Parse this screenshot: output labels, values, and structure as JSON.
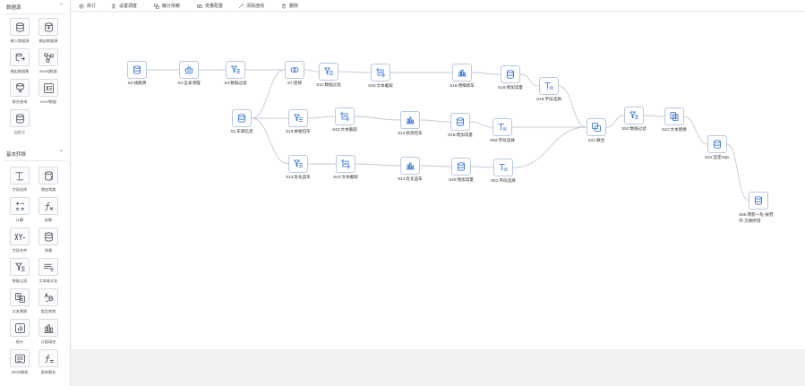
{
  "sidebar": {
    "sections": [
      {
        "title": "数据源",
        "items": [
          {
            "label": "输入数据源",
            "icon": "database-input-icon"
          },
          {
            "label": "输出数据源",
            "icon": "database-output-icon"
          },
          {
            "label": "输出数据集",
            "icon": "dataset-output-icon"
          },
          {
            "label": "Neo4j数据",
            "icon": "graph-nodes-icon"
          },
          {
            "label": "联合查询",
            "icon": "union-query-icon"
          },
          {
            "label": "excel数据",
            "icon": "excel-icon"
          },
          {
            "label": "自定义",
            "icon": "custom-database-icon"
          }
        ]
      },
      {
        "title": "基本转换",
        "items": [
          {
            "label": "字段选择",
            "icon": "field-select-icon"
          },
          {
            "label": "增加常量",
            "icon": "add-constant-icon"
          },
          {
            "label": "计算",
            "icon": "calculator-icon"
          },
          {
            "label": "函数",
            "icon": "function-icon"
          },
          {
            "label": "字段合并",
            "icon": "xy-merge-icon"
          },
          {
            "label": "排重",
            "icon": "dedupe-icon"
          },
          {
            "label": "数据过滤",
            "icon": "filter-icon"
          },
          {
            "label": "文本格式化",
            "icon": "text-format-icon"
          },
          {
            "label": "文本替换",
            "icon": "text-replace-icon"
          },
          {
            "label": "类型转换",
            "icon": "type-convert-icon"
          },
          {
            "label": "统计",
            "icon": "stats-icon"
          },
          {
            "label": "分值填充",
            "icon": "value-fill-icon"
          },
          {
            "label": "JSON解析",
            "icon": "json-parse-icon"
          },
          {
            "label": "表单解析",
            "icon": "form-parse-icon"
          }
        ]
      }
    ]
  },
  "toolbar": {
    "items": [
      {
        "label": "执行",
        "icon": "play-icon"
      },
      {
        "label": "设置调度",
        "icon": "schedule-icon"
      },
      {
        "label": "触分依赖",
        "icon": "dependency-icon"
      },
      {
        "label": "变量配置",
        "icon": "variable-icon"
      },
      {
        "label": "清除连线",
        "icon": "clear-lines-icon"
      },
      {
        "label": "删除",
        "icon": "delete-icon"
      }
    ]
  },
  "flow": {
    "nodes": [
      {
        "id": "n1",
        "label": "S2:线路牌",
        "icon": "database"
      },
      {
        "id": "n2",
        "label": "S4:全表清理",
        "icon": "basket"
      },
      {
        "id": "n3",
        "label": "S3:数据过滤",
        "icon": "filter"
      },
      {
        "id": "n4",
        "label": "S7:连接",
        "icon": "join"
      },
      {
        "id": "n5",
        "label": "S11:数据过滤",
        "icon": "filter"
      },
      {
        "id": "n6",
        "label": "S40:文本截取",
        "icon": "crop"
      },
      {
        "id": "n7",
        "label": "S15:明细寄车",
        "icon": "bars"
      },
      {
        "id": "n8",
        "label": "S18:增加常量",
        "icon": "database"
      },
      {
        "id": "n9",
        "label": "S49:字段选择",
        "icon": "field"
      },
      {
        "id": "n10",
        "label": "S1:车辆信息",
        "icon": "database"
      },
      {
        "id": "n11",
        "label": "S10:依据包车",
        "icon": "filter"
      },
      {
        "id": "n12",
        "label": "S43:文本截取",
        "icon": "crop"
      },
      {
        "id": "n13",
        "label": "S12:统源包车",
        "icon": "bars"
      },
      {
        "id": "n14",
        "label": "S19:增加常量",
        "icon": "database"
      },
      {
        "id": "n15",
        "label": "S50:字段选择",
        "icon": "field"
      },
      {
        "id": "n16",
        "label": "S21:联合",
        "icon": "merge"
      },
      {
        "id": "n17",
        "label": "S52:数据过滤",
        "icon": "filter"
      },
      {
        "id": "n18",
        "label": "S41:文本替换",
        "icon": "copy"
      },
      {
        "id": "n19",
        "label": "S31:自定SQL",
        "icon": "database"
      },
      {
        "id": "n20",
        "label": "S13:危化品车",
        "icon": "filter"
      },
      {
        "id": "n21",
        "label": "S44:文本截取",
        "icon": "crop"
      },
      {
        "id": "n22",
        "label": "S14:危化品车",
        "icon": "bars"
      },
      {
        "id": "n23",
        "label": "S20:增加常量",
        "icon": "database"
      },
      {
        "id": "n24",
        "label": "S51:字段选择",
        "icon": "field"
      },
      {
        "id": "n25",
        "label": "S55:两客一危-按营市-交换所得",
        "icon": "database"
      }
    ]
  },
  "colors": {
    "accent": "#2f6fd6",
    "edge": "#c3c9d4",
    "nodeBorder": "#b9c8e2"
  }
}
